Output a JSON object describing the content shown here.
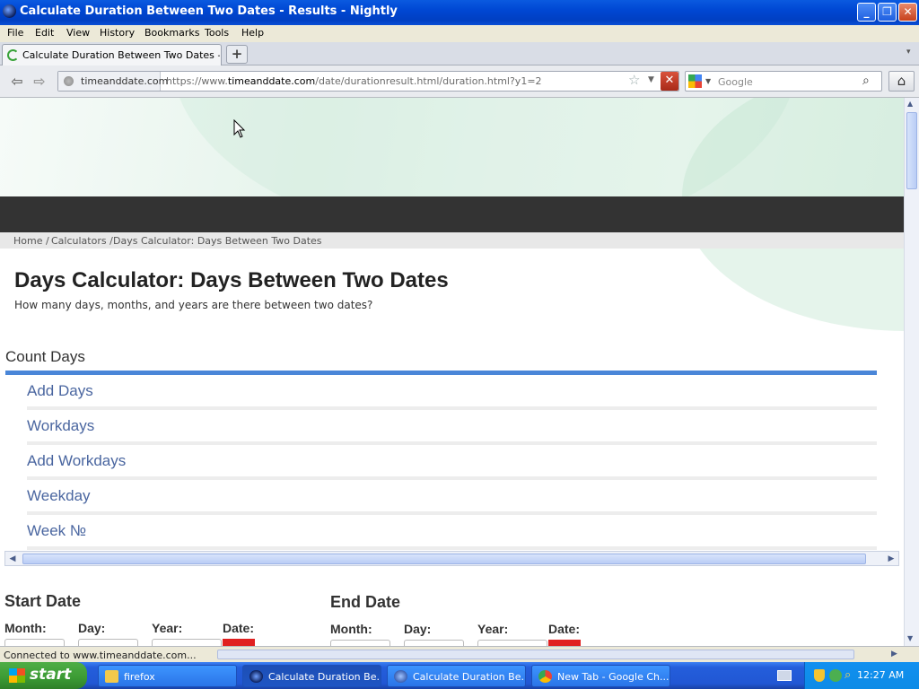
{
  "window": {
    "title": "Calculate Duration Between Two Dates - Results - Nightly"
  },
  "menu": [
    "File",
    "Edit",
    "View",
    "History",
    "Bookmarks",
    "Tools",
    "Help"
  ],
  "tab": {
    "label": "Calculate Duration Between Two Dates – Re...",
    "new_tab": "+"
  },
  "nav": {
    "identity": "timeanddate.com",
    "url_prefix": "https://www.",
    "url_domain": "timeanddate.com",
    "url_path": "/date/durationresult.html/duration.html?y1=2",
    "search_placeholder": "Google"
  },
  "breadcrumb": [
    "Home /",
    "Calculators /",
    "Days Calculator: Days Between Two Dates"
  ],
  "page": {
    "title": "Days Calculator: Days Between Two Dates",
    "subtitle": "How many days, months, and years are there between two dates?"
  },
  "calc_nav": {
    "current": "Count Days",
    "links": [
      "Add Days",
      "Workdays",
      "Add Workdays",
      "Weekday",
      "Week №"
    ]
  },
  "start": {
    "heading": "Start Date",
    "month": "Month:",
    "day": "Day:",
    "year": "Year:",
    "date": "Date:"
  },
  "end": {
    "heading": "End Date",
    "month": "Month:",
    "day": "Day:",
    "year": "Year:",
    "date": "Date:"
  },
  "status": {
    "text": "Connected to www.timeanddate.com..."
  },
  "taskbar": {
    "start": "start",
    "items": [
      "firefox",
      "Calculate Duration Be...",
      "Calculate Duration Be...",
      "New Tab - Google Ch..."
    ],
    "clock": "12:27 AM"
  }
}
